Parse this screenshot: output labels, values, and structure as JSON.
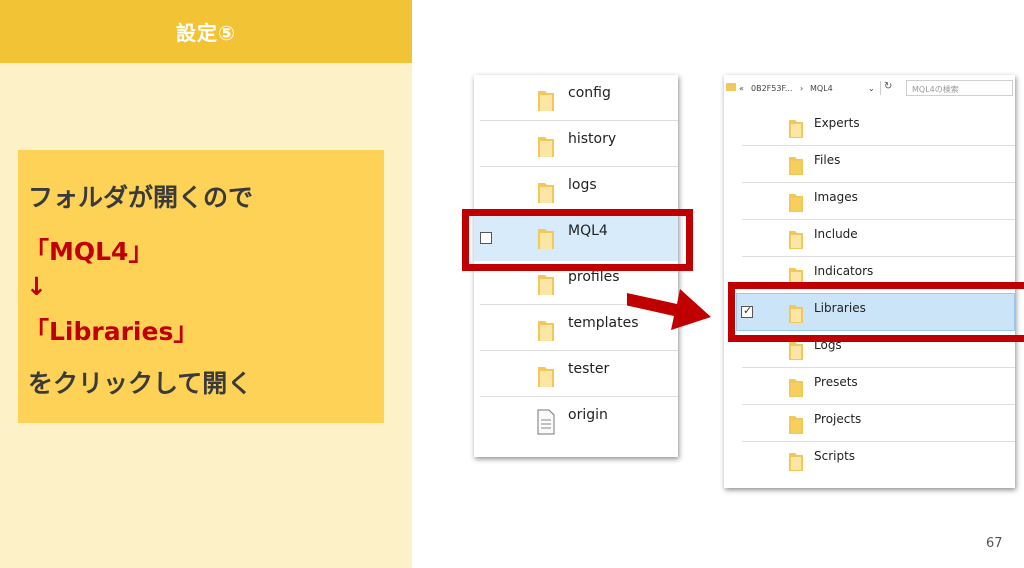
{
  "slide": {
    "header_title": "設定⑤",
    "page_number": "67"
  },
  "callout": {
    "line1": "フォルダが開くので",
    "line2": "「MQL4」",
    "line3": "↓",
    "line4": "「Libraries」",
    "line5": "をクリックして開く"
  },
  "explorer_left": {
    "items": [
      {
        "label": "config",
        "icon": "folder-icon"
      },
      {
        "label": "history",
        "icon": "folder-icon"
      },
      {
        "label": "logs",
        "icon": "folder-icon"
      },
      {
        "label": "MQL4",
        "icon": "folder-icon",
        "selected": true
      },
      {
        "label": "profiles",
        "icon": "folder-icon"
      },
      {
        "label": "templates",
        "icon": "folder-icon"
      },
      {
        "label": "tester",
        "icon": "folder-icon"
      },
      {
        "label": "origin",
        "icon": "document-icon"
      }
    ]
  },
  "explorer_right": {
    "address": {
      "chevron": "«",
      "crumb1": "0B2F53F...",
      "sep": "›",
      "crumb2": "MQL4",
      "dropdown": "⌄",
      "refresh": "↻",
      "search_placeholder": "MQL4の検索"
    },
    "items": [
      {
        "label": "Experts",
        "icon": "folder-icon"
      },
      {
        "label": "Files",
        "icon": "folder-icon"
      },
      {
        "label": "Images",
        "icon": "folder-icon"
      },
      {
        "label": "Include",
        "icon": "folder-icon"
      },
      {
        "label": "Indicators",
        "icon": "folder-icon"
      },
      {
        "label": "Libraries",
        "icon": "folder-icon",
        "selected": true
      },
      {
        "label": "Logs",
        "icon": "folder-icon"
      },
      {
        "label": "Presets",
        "icon": "folder-icon"
      },
      {
        "label": "Projects",
        "icon": "folder-icon"
      },
      {
        "label": "Scripts",
        "icon": "folder-icon"
      }
    ]
  },
  "colors": {
    "header": "#f3c336",
    "panel": "#fdf1c7",
    "callout": "#fdd257",
    "highlight": "#c00000",
    "folder": "#f2c85b"
  }
}
